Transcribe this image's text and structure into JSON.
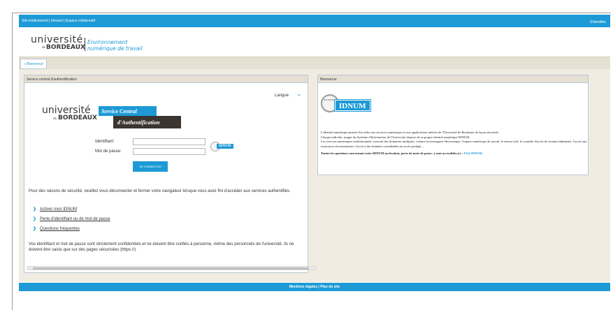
{
  "topbar": {
    "links": "Site institutionnel | Intranet | Espace collaboratif",
    "login": "S'identifier"
  },
  "header": {
    "univ_name": "université",
    "univ_city": "BORDEAUX",
    "univ_de": "de",
    "env_line1": "Environnement",
    "env_line2": "numérique de travail"
  },
  "breadcrumb": {
    "label": "« Bienvenue"
  },
  "auth_panel": {
    "title": "Service central d'authentification",
    "language_label": "Langue",
    "logo_service_line1": "Service Central",
    "logo_service_line2": "d'Authentification",
    "identifiant_label": "Identifiant:",
    "password_label": "Mot de passe:",
    "identifiant_value": "",
    "password_value": "",
    "idnum_badge": "IDNUM",
    "login_button": "SE CONNECTER",
    "security_text": "Pour des raisons de sécurité, veuillez vous déconnecter et fermer votre navigateur lorsque vous avez fini d'accéder aux services authentifiés.",
    "links": [
      "Activer mon IDNUM",
      "Perte d'identifiant ou de mot de passe",
      "Questions fréquentes"
    ],
    "warning_text": "Vos identifiant et mot de passe sont strictement confidentiels et ne doivent être confiés à personne, même des personnels de l'université. Ils ne doivent être saisis que sur des pages sécurisées (https://)."
  },
  "welcome_panel": {
    "title": "Bienvenue",
    "idnum_title": "IDNUM",
    "seal_text": "NUMERIQUE",
    "para1": "L'identité numérique permet d'accéder aux services numériques et aux applications métiers de l'Université de Bordeaux de façon sécurisée.",
    "para2": "Chaque individu, usager du Système d'Information de l'Université dispose de sa propre identité numérique IDNUM.",
    "para3": "Les services numériques institutionnels couvrent des domaines multiples, comme la messagerie électronique, l'espace numérique de travail, le réseau wifi, le contrôle d'accès de certains bâtiments, l'accès aux ressources documentaires, l'accès à des données consultables en accès protégé ...",
    "faq_text": "Toutes les questions concernant votre IDNUM (activation, perte de mots de passe...) sont accessibles ici :",
    "faq_link": "FAQ IDNUM"
  },
  "footer": {
    "text": "Mentions légales | Plan du site"
  },
  "colors": {
    "accent": "#1d9ad6",
    "beige": "#e6e0d3",
    "dark_label": "#3b3530"
  }
}
